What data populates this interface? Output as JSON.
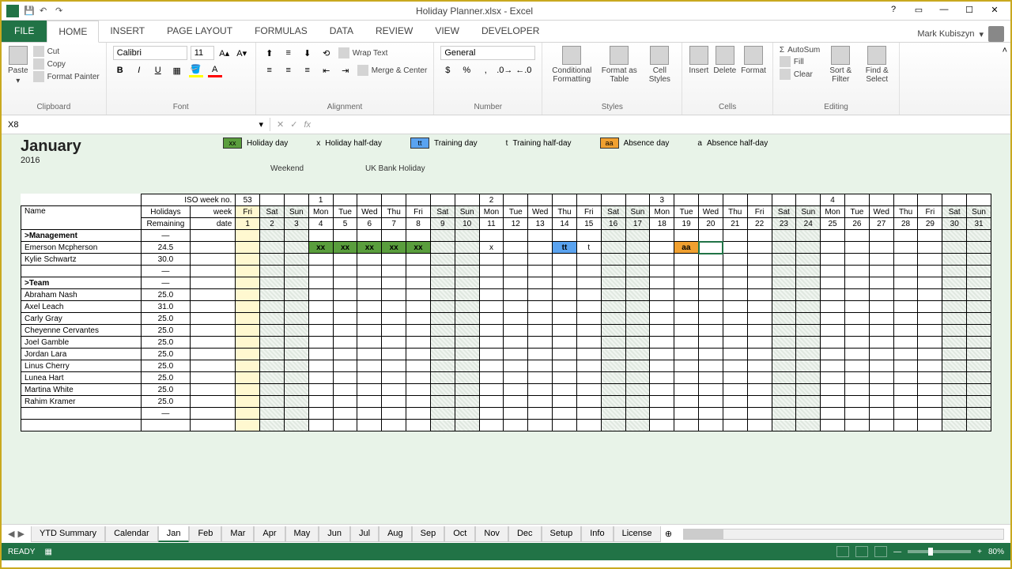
{
  "title": "Holiday Planner.xlsx - Excel",
  "user": "Mark Kubiszyn",
  "ribbon_tabs": [
    "FILE",
    "HOME",
    "INSERT",
    "PAGE LAYOUT",
    "FORMULAS",
    "DATA",
    "REVIEW",
    "VIEW",
    "DEVELOPER"
  ],
  "active_ribbon": "HOME",
  "groups": {
    "clipboard": {
      "label": "Clipboard",
      "paste": "Paste",
      "cut": "Cut",
      "copy": "Copy",
      "fmt": "Format Painter"
    },
    "font": {
      "label": "Font",
      "name": "Calibri",
      "size": "11"
    },
    "alignment": {
      "label": "Alignment",
      "wrap": "Wrap Text",
      "merge": "Merge & Center"
    },
    "number": {
      "label": "Number",
      "fmt": "General"
    },
    "styles": {
      "label": "Styles",
      "cf": "Conditional Formatting",
      "ft": "Format as Table",
      "cs": "Cell Styles"
    },
    "cells": {
      "label": "Cells",
      "ins": "Insert",
      "del": "Delete",
      "fmt": "Format"
    },
    "editing": {
      "label": "Editing",
      "sum": "AutoSum",
      "fill": "Fill",
      "clear": "Clear",
      "sort": "Sort & Filter",
      "find": "Find & Select"
    }
  },
  "namebox": "X8",
  "month": "January",
  "year": "2016",
  "legend": {
    "xx": "Holiday day",
    "x": "Holiday half-day",
    "tt": "Training day",
    "t": "Training half-day",
    "aa": "Absence day",
    "a": "Absence half-day"
  },
  "overlay": {
    "weekend": "Weekend",
    "bank": "UK Bank Holiday"
  },
  "headers": {
    "name": "Name",
    "holidays": "Holidays",
    "remaining": "Remaining",
    "iso": "ISO week no.",
    "week": "week",
    "date": "date"
  },
  "iso_weeks": [
    "53",
    "",
    "",
    "1",
    "",
    "",
    "",
    "",
    "",
    "",
    "2",
    "",
    "",
    "",
    "",
    "",
    "",
    "3",
    "",
    "",
    "",
    "",
    "",
    "",
    "4",
    "",
    "",
    "",
    "",
    "",
    ""
  ],
  "days_week": [
    "Fri",
    "Sat",
    "Sun",
    "Mon",
    "Tue",
    "Wed",
    "Thu",
    "Fri",
    "Sat",
    "Sun",
    "Mon",
    "Tue",
    "Wed",
    "Thu",
    "Fri",
    "Sat",
    "Sun",
    "Mon",
    "Tue",
    "Wed",
    "Thu",
    "Fri",
    "Sat",
    "Sun",
    "Mon",
    "Tue",
    "Wed",
    "Thu",
    "Fri",
    "Sat",
    "Sun"
  ],
  "dates": [
    "1",
    "2",
    "3",
    "4",
    "5",
    "6",
    "7",
    "8",
    "9",
    "10",
    "11",
    "12",
    "13",
    "14",
    "15",
    "16",
    "17",
    "18",
    "19",
    "20",
    "21",
    "22",
    "23",
    "24",
    "25",
    "26",
    "27",
    "28",
    "29",
    "30",
    "31"
  ],
  "weekend_idx": [
    1,
    2,
    8,
    9,
    15,
    16,
    22,
    23,
    29,
    30
  ],
  "bank_idx": [
    0
  ],
  "rows": [
    {
      "type": "group",
      "name": ">Management",
      "rem": "—"
    },
    {
      "type": "person",
      "name": "Emerson Mcpherson",
      "rem": "24.5",
      "cells": {
        "3": "xx",
        "4": "xx",
        "5": "xx",
        "6": "xx",
        "7": "xx",
        "10": "x",
        "13": "tt",
        "14": "t",
        "18": "aa"
      },
      "styles": {
        "3": "xx",
        "4": "xx",
        "5": "xx",
        "6": "xx",
        "7": "xx",
        "13": "tt",
        "18": "aa"
      }
    },
    {
      "type": "person",
      "name": "Kylie Schwartz",
      "rem": "30.0"
    },
    {
      "type": "blank",
      "rem": "—"
    },
    {
      "type": "group",
      "name": ">Team",
      "rem": "—"
    },
    {
      "type": "person",
      "name": "Abraham Nash",
      "rem": "25.0"
    },
    {
      "type": "person",
      "name": "Axel Leach",
      "rem": "31.0"
    },
    {
      "type": "person",
      "name": "Carly Gray",
      "rem": "25.0"
    },
    {
      "type": "person",
      "name": "Cheyenne Cervantes",
      "rem": "25.0"
    },
    {
      "type": "person",
      "name": "Joel Gamble",
      "rem": "25.0"
    },
    {
      "type": "person",
      "name": "Jordan Lara",
      "rem": "25.0"
    },
    {
      "type": "person",
      "name": "Linus Cherry",
      "rem": "25.0"
    },
    {
      "type": "person",
      "name": "Lunea Hart",
      "rem": "25.0"
    },
    {
      "type": "person",
      "name": "Martina White",
      "rem": "25.0"
    },
    {
      "type": "person",
      "name": "Rahim Kramer",
      "rem": "25.0"
    },
    {
      "type": "blank",
      "rem": "—"
    },
    {
      "type": "blank",
      "rem": ""
    }
  ],
  "selected_cell": {
    "row": 1,
    "col": 19
  },
  "sheet_tabs": [
    "YTD Summary",
    "Calendar",
    "Jan",
    "Feb",
    "Mar",
    "Apr",
    "May",
    "Jun",
    "Jul",
    "Aug",
    "Sep",
    "Oct",
    "Nov",
    "Dec",
    "Setup",
    "Info",
    "License"
  ],
  "active_sheet": "Jan",
  "status": "READY",
  "zoom": "80%"
}
